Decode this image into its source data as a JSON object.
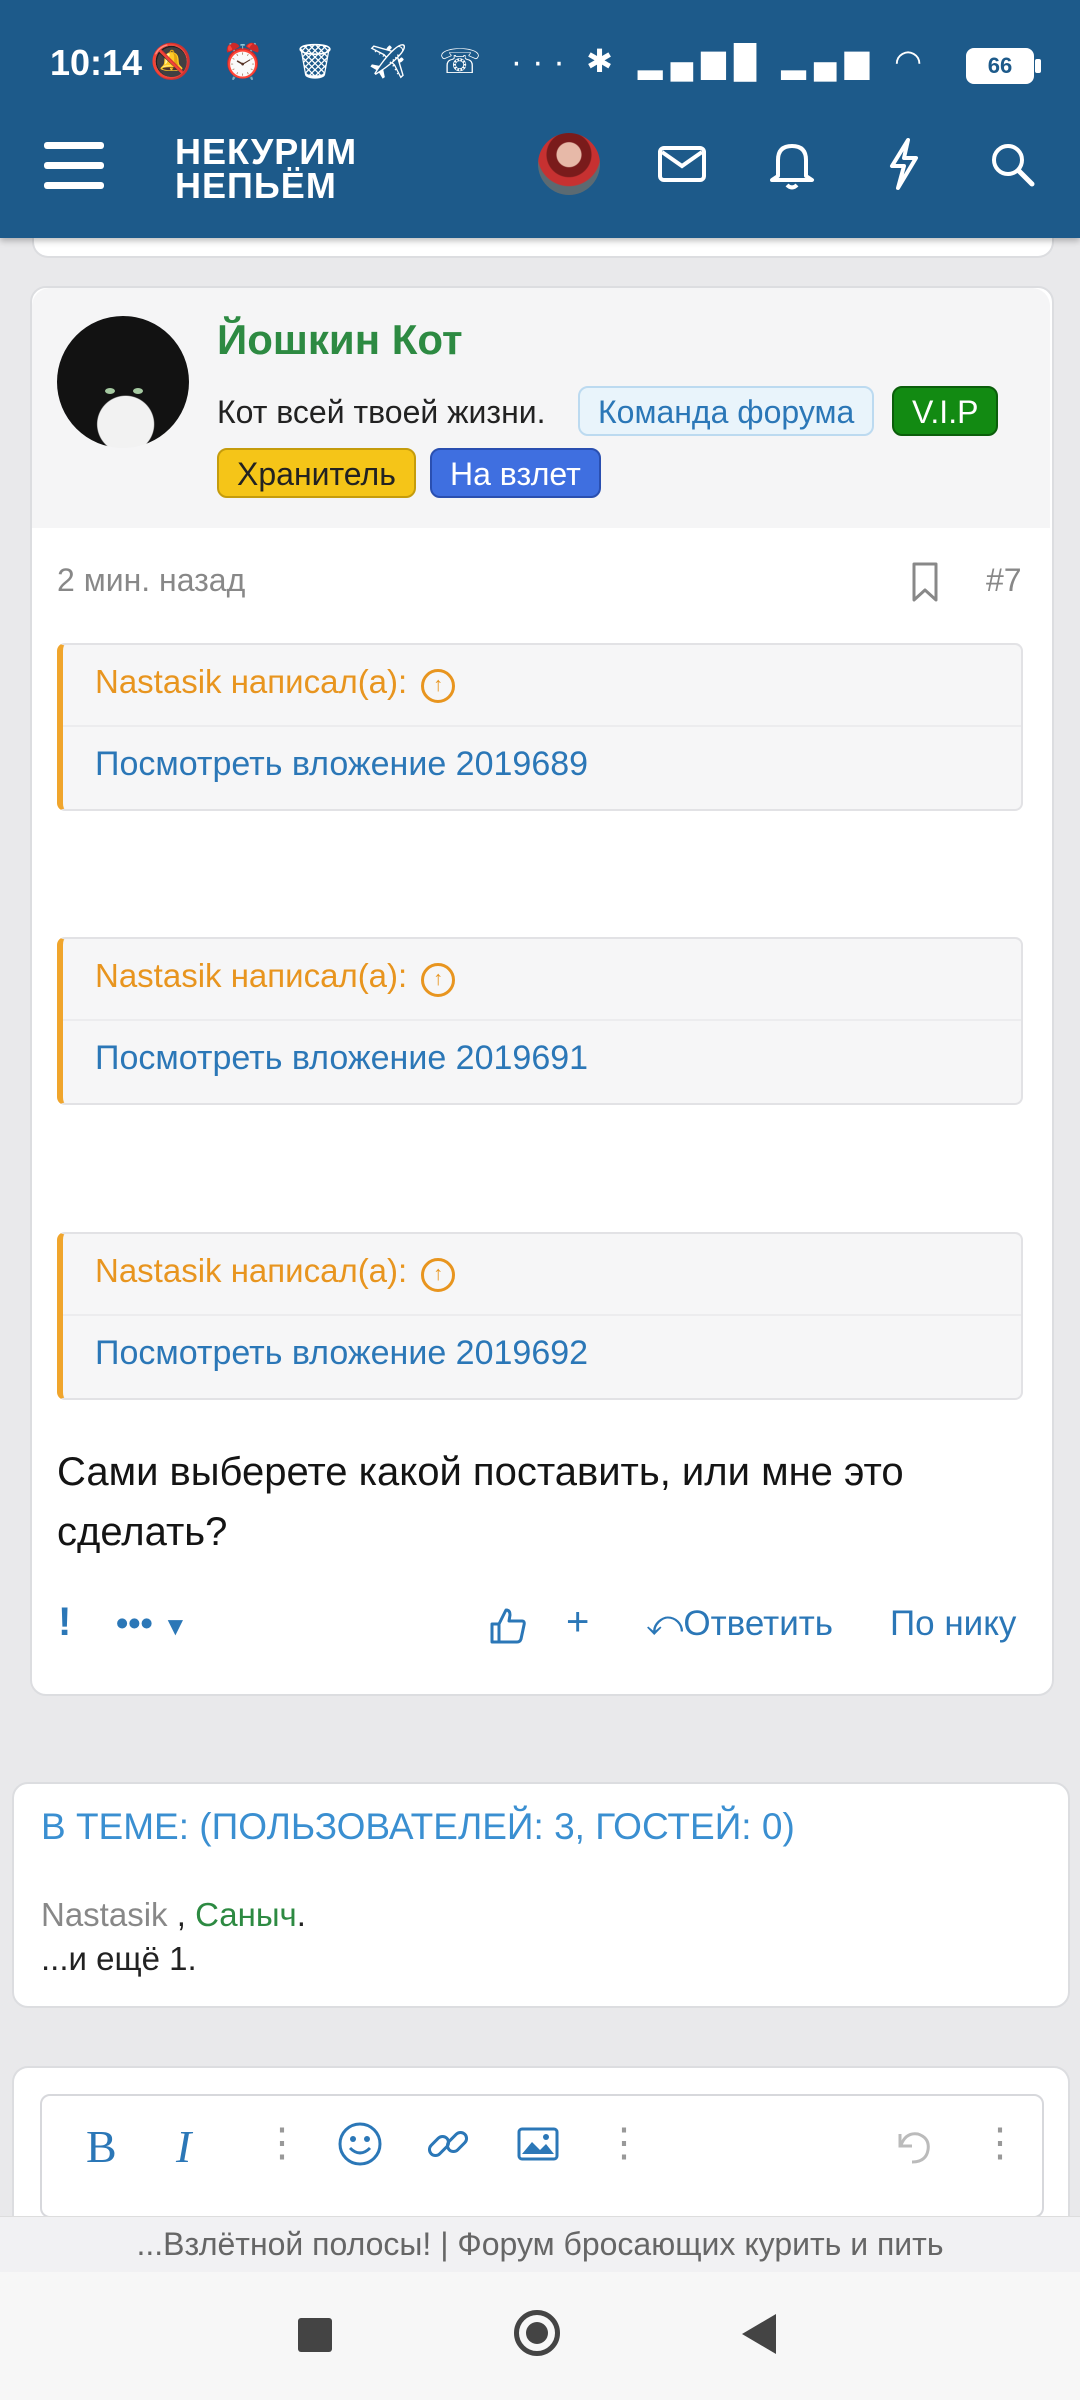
{
  "status_bar": {
    "time": "10:14",
    "notif_icons": "🔕 ⏰ 🗑 ✈ ☏ ···",
    "system_icons": "✱ ▂▄▆█ ▂▄▆ ◠",
    "battery": "66"
  },
  "header": {
    "logo_line1": "НЕКУРИМ",
    "logo_line2": "НЕПЬЁМ"
  },
  "post": {
    "username": "Йошкин Кот",
    "user_title": "Кот всей твоей жизни.",
    "badges": {
      "team": "Команда форума",
      "vip": "V.I.P",
      "keeper": "Хранитель",
      "takeoff": "На взлет"
    },
    "time": "2 мин. назад",
    "number": "#7",
    "quotes": [
      {
        "author": "Nastasik написал(а):",
        "link": "Посмотреть вложение 2019689"
      },
      {
        "author": "Nastasik написал(а):",
        "link": "Посмотреть вложение 2019691"
      },
      {
        "author": "Nastasik написал(а):",
        "link": "Посмотреть вложение 2019692"
      }
    ],
    "message": "Сами выберете какой поставить, или мне это сделать?",
    "actions": {
      "report": "!",
      "more": "•••",
      "reply": "Ответить",
      "by_nick": "По нику",
      "plus": "+"
    }
  },
  "online": {
    "title": "В ТЕМЕ: (ПОЛЬЗОВАТЕЛЕЙ: 3, ГОСТЕЙ: 0)",
    "user1": "Nastasik",
    "separator": " , ",
    "user2": "Саныч",
    "dot": ".",
    "more": "...и ещё 1."
  },
  "editor": {
    "bold": "B",
    "italic": "I"
  },
  "footer": {
    "page_title": "...Взлётной полосы! | Форум бросающих курить и пить"
  },
  "colors": {
    "header_bg": "#1d5a8a",
    "username": "#2d8a42",
    "link": "#2b77b7",
    "quote_accent": "#f0a52c"
  }
}
